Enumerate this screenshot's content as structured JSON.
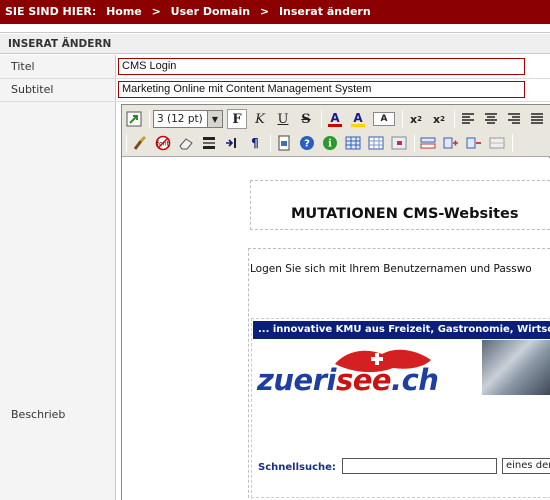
{
  "breadcrumb": {
    "prefix": "SIE SIND HIER:",
    "items": [
      "Home",
      "User Domain",
      "Inserat ändern"
    ],
    "separator": ">"
  },
  "section": {
    "title": "INSERAT ÄNDERN"
  },
  "form": {
    "titel_label": "Titel",
    "titel_value": "CMS Login",
    "subtitel_label": "Subtitel",
    "subtitel_value": "Marketing Online mit Content Management System",
    "beschrieb_label": "Beschrieb"
  },
  "toolbar": {
    "font_size_value": "3 (12 pt)",
    "bold_label": "F",
    "italic_label": "K",
    "underline_label": "U",
    "strike_label": "S",
    "font_color_label": "A",
    "highlight_label": "A",
    "font_label": "A"
  },
  "editor_content": {
    "heading": "MUTATIONEN CMS-Websites",
    "login_text": "Logen Sie sich mit Ihrem Benutzernamen und Passwo",
    "banner_text": "... innovative KMU aus Freizeit, Gastronomie, Wirtsc",
    "brand_part1": "zueri",
    "brand_part2": "see",
    "brand_part3": ".ch",
    "schnellsuche_label": "Schnellsuche:",
    "schnellsuche_select": "eines der"
  },
  "colors": {
    "topbar": "#8b0000",
    "input_border": "#a40000",
    "banner": "#0a1e7a",
    "brand_blue": "#1e3fa0",
    "brand_red": "#cc1111"
  }
}
